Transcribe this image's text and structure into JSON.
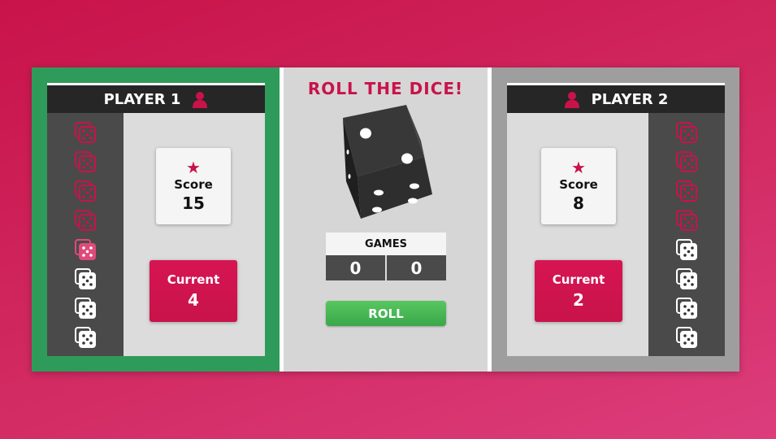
{
  "center": {
    "title": "ROLL THE DICE!",
    "current_die_face": 5,
    "games_label": "GAMES",
    "games_scores": [
      "0",
      "0"
    ],
    "roll_button": "ROLL"
  },
  "players": [
    {
      "name": "PLAYER 1",
      "active": true,
      "score_label": "Score",
      "score": "15",
      "current_label": "Current",
      "current": "4",
      "used_dice": 5,
      "total_dice": 8
    },
    {
      "name": "PLAYER 2",
      "active": false,
      "score_label": "Score",
      "score": "8",
      "current_label": "Current",
      "current": "2",
      "used_dice": 4,
      "total_dice": 8
    }
  ],
  "colors": {
    "accent": "#c8134a",
    "active_player": "#2f9b5a",
    "inactive_player": "#9e9e9e",
    "roll_button": "#4cba55",
    "die_body": "#3a3a3a"
  },
  "icons": {
    "player": "person-icon",
    "score": "star-icon",
    "dice": "die-icon"
  }
}
